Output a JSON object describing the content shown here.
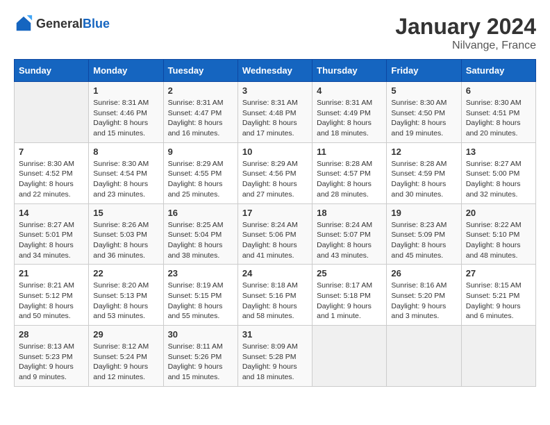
{
  "header": {
    "logo_general": "General",
    "logo_blue": "Blue",
    "title": "January 2024",
    "location": "Nilvange, France"
  },
  "calendar": {
    "days_of_week": [
      "Sunday",
      "Monday",
      "Tuesday",
      "Wednesday",
      "Thursday",
      "Friday",
      "Saturday"
    ],
    "weeks": [
      [
        {
          "day": "",
          "sunrise": "",
          "sunset": "",
          "daylight": "",
          "empty": true
        },
        {
          "day": "1",
          "sunrise": "Sunrise: 8:31 AM",
          "sunset": "Sunset: 4:46 PM",
          "daylight": "Daylight: 8 hours and 15 minutes.",
          "empty": false
        },
        {
          "day": "2",
          "sunrise": "Sunrise: 8:31 AM",
          "sunset": "Sunset: 4:47 PM",
          "daylight": "Daylight: 8 hours and 16 minutes.",
          "empty": false
        },
        {
          "day": "3",
          "sunrise": "Sunrise: 8:31 AM",
          "sunset": "Sunset: 4:48 PM",
          "daylight": "Daylight: 8 hours and 17 minutes.",
          "empty": false
        },
        {
          "day": "4",
          "sunrise": "Sunrise: 8:31 AM",
          "sunset": "Sunset: 4:49 PM",
          "daylight": "Daylight: 8 hours and 18 minutes.",
          "empty": false
        },
        {
          "day": "5",
          "sunrise": "Sunrise: 8:30 AM",
          "sunset": "Sunset: 4:50 PM",
          "daylight": "Daylight: 8 hours and 19 minutes.",
          "empty": false
        },
        {
          "day": "6",
          "sunrise": "Sunrise: 8:30 AM",
          "sunset": "Sunset: 4:51 PM",
          "daylight": "Daylight: 8 hours and 20 minutes.",
          "empty": false
        }
      ],
      [
        {
          "day": "7",
          "sunrise": "Sunrise: 8:30 AM",
          "sunset": "Sunset: 4:52 PM",
          "daylight": "Daylight: 8 hours and 22 minutes.",
          "empty": false
        },
        {
          "day": "8",
          "sunrise": "Sunrise: 8:30 AM",
          "sunset": "Sunset: 4:54 PM",
          "daylight": "Daylight: 8 hours and 23 minutes.",
          "empty": false
        },
        {
          "day": "9",
          "sunrise": "Sunrise: 8:29 AM",
          "sunset": "Sunset: 4:55 PM",
          "daylight": "Daylight: 8 hours and 25 minutes.",
          "empty": false
        },
        {
          "day": "10",
          "sunrise": "Sunrise: 8:29 AM",
          "sunset": "Sunset: 4:56 PM",
          "daylight": "Daylight: 8 hours and 27 minutes.",
          "empty": false
        },
        {
          "day": "11",
          "sunrise": "Sunrise: 8:28 AM",
          "sunset": "Sunset: 4:57 PM",
          "daylight": "Daylight: 8 hours and 28 minutes.",
          "empty": false
        },
        {
          "day": "12",
          "sunrise": "Sunrise: 8:28 AM",
          "sunset": "Sunset: 4:59 PM",
          "daylight": "Daylight: 8 hours and 30 minutes.",
          "empty": false
        },
        {
          "day": "13",
          "sunrise": "Sunrise: 8:27 AM",
          "sunset": "Sunset: 5:00 PM",
          "daylight": "Daylight: 8 hours and 32 minutes.",
          "empty": false
        }
      ],
      [
        {
          "day": "14",
          "sunrise": "Sunrise: 8:27 AM",
          "sunset": "Sunset: 5:01 PM",
          "daylight": "Daylight: 8 hours and 34 minutes.",
          "empty": false
        },
        {
          "day": "15",
          "sunrise": "Sunrise: 8:26 AM",
          "sunset": "Sunset: 5:03 PM",
          "daylight": "Daylight: 8 hours and 36 minutes.",
          "empty": false
        },
        {
          "day": "16",
          "sunrise": "Sunrise: 8:25 AM",
          "sunset": "Sunset: 5:04 PM",
          "daylight": "Daylight: 8 hours and 38 minutes.",
          "empty": false
        },
        {
          "day": "17",
          "sunrise": "Sunrise: 8:24 AM",
          "sunset": "Sunset: 5:06 PM",
          "daylight": "Daylight: 8 hours and 41 minutes.",
          "empty": false
        },
        {
          "day": "18",
          "sunrise": "Sunrise: 8:24 AM",
          "sunset": "Sunset: 5:07 PM",
          "daylight": "Daylight: 8 hours and 43 minutes.",
          "empty": false
        },
        {
          "day": "19",
          "sunrise": "Sunrise: 8:23 AM",
          "sunset": "Sunset: 5:09 PM",
          "daylight": "Daylight: 8 hours and 45 minutes.",
          "empty": false
        },
        {
          "day": "20",
          "sunrise": "Sunrise: 8:22 AM",
          "sunset": "Sunset: 5:10 PM",
          "daylight": "Daylight: 8 hours and 48 minutes.",
          "empty": false
        }
      ],
      [
        {
          "day": "21",
          "sunrise": "Sunrise: 8:21 AM",
          "sunset": "Sunset: 5:12 PM",
          "daylight": "Daylight: 8 hours and 50 minutes.",
          "empty": false
        },
        {
          "day": "22",
          "sunrise": "Sunrise: 8:20 AM",
          "sunset": "Sunset: 5:13 PM",
          "daylight": "Daylight: 8 hours and 53 minutes.",
          "empty": false
        },
        {
          "day": "23",
          "sunrise": "Sunrise: 8:19 AM",
          "sunset": "Sunset: 5:15 PM",
          "daylight": "Daylight: 8 hours and 55 minutes.",
          "empty": false
        },
        {
          "day": "24",
          "sunrise": "Sunrise: 8:18 AM",
          "sunset": "Sunset: 5:16 PM",
          "daylight": "Daylight: 8 hours and 58 minutes.",
          "empty": false
        },
        {
          "day": "25",
          "sunrise": "Sunrise: 8:17 AM",
          "sunset": "Sunset: 5:18 PM",
          "daylight": "Daylight: 9 hours and 1 minute.",
          "empty": false
        },
        {
          "day": "26",
          "sunrise": "Sunrise: 8:16 AM",
          "sunset": "Sunset: 5:20 PM",
          "daylight": "Daylight: 9 hours and 3 minutes.",
          "empty": false
        },
        {
          "day": "27",
          "sunrise": "Sunrise: 8:15 AM",
          "sunset": "Sunset: 5:21 PM",
          "daylight": "Daylight: 9 hours and 6 minutes.",
          "empty": false
        }
      ],
      [
        {
          "day": "28",
          "sunrise": "Sunrise: 8:13 AM",
          "sunset": "Sunset: 5:23 PM",
          "daylight": "Daylight: 9 hours and 9 minutes.",
          "empty": false
        },
        {
          "day": "29",
          "sunrise": "Sunrise: 8:12 AM",
          "sunset": "Sunset: 5:24 PM",
          "daylight": "Daylight: 9 hours and 12 minutes.",
          "empty": false
        },
        {
          "day": "30",
          "sunrise": "Sunrise: 8:11 AM",
          "sunset": "Sunset: 5:26 PM",
          "daylight": "Daylight: 9 hours and 15 minutes.",
          "empty": false
        },
        {
          "day": "31",
          "sunrise": "Sunrise: 8:09 AM",
          "sunset": "Sunset: 5:28 PM",
          "daylight": "Daylight: 9 hours and 18 minutes.",
          "empty": false
        },
        {
          "day": "",
          "sunrise": "",
          "sunset": "",
          "daylight": "",
          "empty": true
        },
        {
          "day": "",
          "sunrise": "",
          "sunset": "",
          "daylight": "",
          "empty": true
        },
        {
          "day": "",
          "sunrise": "",
          "sunset": "",
          "daylight": "",
          "empty": true
        }
      ]
    ]
  }
}
